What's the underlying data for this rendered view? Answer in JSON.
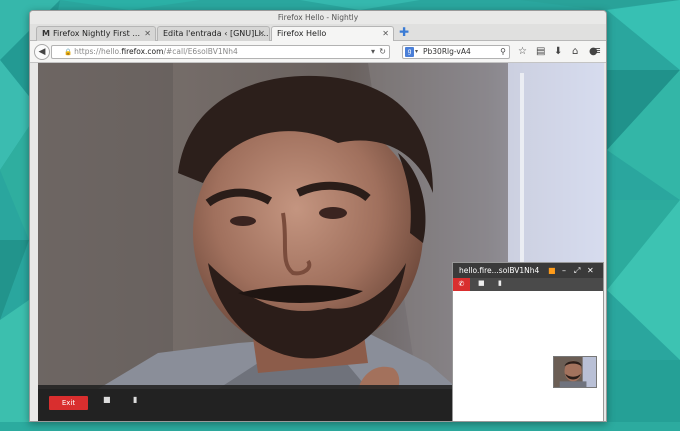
{
  "window": {
    "title": "Firefox Hello - Nightly"
  },
  "tabs": [
    {
      "label": "Firefox Nightly First ...",
      "favicon": "M",
      "active": false
    },
    {
      "label": "Edita l'entrada ‹ [GNU]Li...",
      "active": false
    },
    {
      "label": "Firefox Hello",
      "active": true
    }
  ],
  "navbar": {
    "url_prefix": "https://hello.",
    "url_host": "firefox.com",
    "url_path": "/#call/E6solBV1Nh4",
    "search_value": "Pb30Rlg-vA4"
  },
  "icons": {
    "back": "back-arrow-icon",
    "lock": "lock-icon",
    "dropdown": "dropdown-arrow-icon",
    "reload": "reload-icon",
    "search": "search-icon",
    "star": "bookmark-star-icon",
    "reader": "bookmarks-menu-icon",
    "download": "download-icon",
    "home": "home-icon",
    "hello": "chat-bubble-icon",
    "menu": "hamburger-menu-icon"
  },
  "call": {
    "exit_label": "Exit",
    "video_icon": "camera-icon",
    "mic_icon": "microphone-icon"
  },
  "conversation": {
    "title": "hello.fire...solBV1Nh4"
  },
  "colors": {
    "wallpaper": "#2ba8a0",
    "exit_button": "#d92e2e",
    "camera_accent": "#ff9c1a"
  }
}
